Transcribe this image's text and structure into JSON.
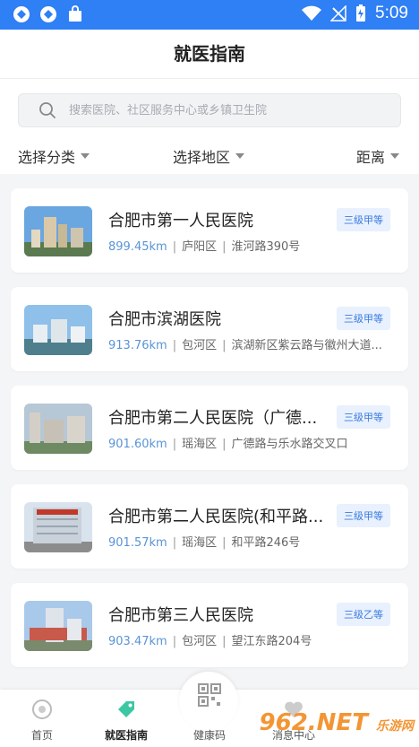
{
  "status_bar": {
    "time": "5:09"
  },
  "header": {
    "title": "就医指南"
  },
  "search": {
    "placeholder": "搜索医院、社区服务中心或乡镇卫生院"
  },
  "filters": {
    "category": "选择分类",
    "region": "选择地区",
    "distance": "距离"
  },
  "hospitals": [
    {
      "name": "合肥市第一人民医院",
      "distance": "899.45km",
      "district": "庐阳区",
      "address": "淮河路390号",
      "level": "三级甲等"
    },
    {
      "name": "合肥市滨湖医院",
      "distance": "913.76km",
      "district": "包河区",
      "address": "滨湖新区紫云路与徽州大道...",
      "level": "三级甲等"
    },
    {
      "name": "合肥市第二人民医院（广德...",
      "distance": "901.60km",
      "district": "瑶海区",
      "address": "广德路与乐水路交叉口",
      "level": "三级甲等"
    },
    {
      "name": "合肥市第二人民医院(和平路...",
      "distance": "901.57km",
      "district": "瑶海区",
      "address": "和平路246号",
      "level": "三级甲等"
    },
    {
      "name": "合肥市第三人民医院",
      "distance": "903.47km",
      "district": "包河区",
      "address": "望江东路204号",
      "level": "三级乙等"
    }
  ],
  "bottom_nav": {
    "home": "首页",
    "guide": "就医指南",
    "health_code": "健康码",
    "messages": "消息中心"
  },
  "watermark": {
    "brand": "962",
    "domain": ".NET",
    "sub": "乐游网"
  },
  "colors": {
    "accent": "#2f7ff5",
    "badge_bg": "#e8f1fd",
    "badge_text": "#3b7be0",
    "distance": "#5a94d6"
  }
}
